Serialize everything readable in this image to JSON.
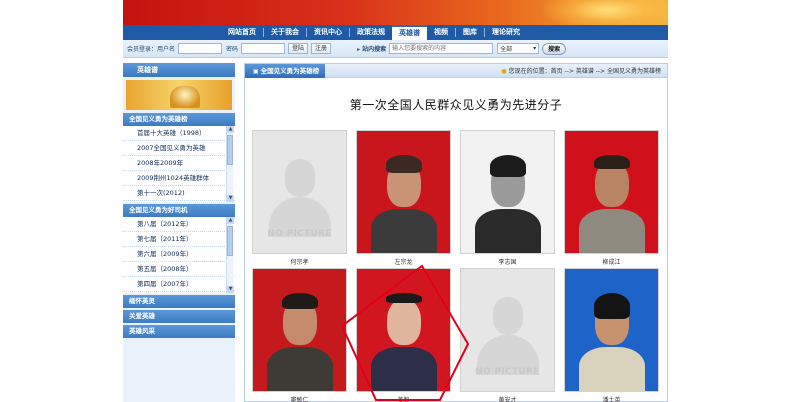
{
  "nav": {
    "items": [
      "网站首页",
      "关于我会",
      "资讯中心",
      "政策法规",
      "英雄谱",
      "视频",
      "图库",
      "理论研究"
    ],
    "active_index": 4
  },
  "login": {
    "user_label": "会员登录：用户名",
    "password_label": "密码",
    "login_button": "登陆",
    "register_button": "注册",
    "search_label": "站内搜索",
    "search_placeholder": "输入您要搜索的内容",
    "scope_value": "全部",
    "search_button": "搜索"
  },
  "sidebar": {
    "title": "英雄谱",
    "section1": {
      "heading": "全国见义勇为英雄榜",
      "items": [
        "首届十大英雄（1998）",
        "2007全国见义勇为英雄",
        "2008年2009年",
        "2009荆州1024英雄群体",
        "第十一次(2012)"
      ]
    },
    "section2": {
      "heading": "全国见义勇为好司机",
      "items": [
        "第八届（2012年）",
        "第七届（2011年）",
        "第六届（2009年）",
        "第五届（2008年）",
        "第四届（2007年）"
      ]
    },
    "links": [
      "缅怀英灵",
      "关爱英雄",
      "英雄风采"
    ]
  },
  "main": {
    "tab_label": "全国见义勇为英雄榜",
    "breadcrumb": "您现在的位置：首页 --> 英雄谱 --> 全国见义勇为英雄榜",
    "page_title": "第一次全国人民群众见义勇为先进分子",
    "no_picture_text": "NO PICTURE",
    "people": [
      {
        "name": "何宗孝",
        "photo": "none"
      },
      {
        "name": "左宗龙",
        "photo": "portrait"
      },
      {
        "name": "李志国",
        "photo": "portrait"
      },
      {
        "name": "柳成江",
        "photo": "portrait"
      },
      {
        "name": "窦敏仁",
        "photo": "portrait"
      },
      {
        "name": "姜智",
        "photo": "portrait"
      },
      {
        "name": "黄安才",
        "photo": "none"
      },
      {
        "name": "潘士英",
        "photo": "portrait"
      }
    ]
  },
  "colors": {
    "nav_blue": "#1f5aa6",
    "banner_red": "#c4120e",
    "annotation_red": "#e0001a"
  }
}
